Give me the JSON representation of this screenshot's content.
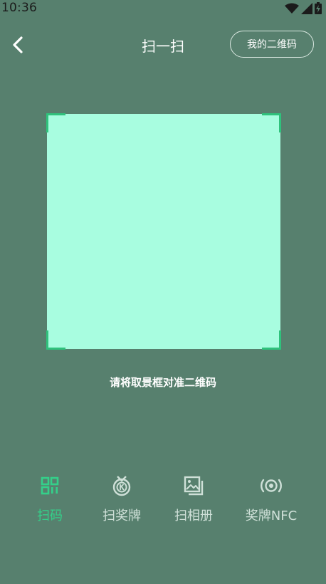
{
  "status_bar": {
    "time": "10:36",
    "icons": [
      "wifi-icon",
      "signal-icon",
      "battery-icon"
    ]
  },
  "header": {
    "back_icon": "chevron-left-icon",
    "title": "扫一扫",
    "my_qr_label": "我的二维码"
  },
  "scanner": {
    "hint": "请将取景框对准二维码",
    "frame_color": "#a8fde0",
    "corner_color": "#2fc27c"
  },
  "tabs": [
    {
      "label": "扫码",
      "icon": "qr-grid-icon",
      "active": true
    },
    {
      "label": "扫奖牌",
      "icon": "medal-icon",
      "active": false
    },
    {
      "label": "扫相册",
      "icon": "album-icon",
      "active": false
    },
    {
      "label": "奖牌NFC",
      "icon": "nfc-icon",
      "active": false
    }
  ],
  "colors": {
    "background": "#57806e",
    "active_tab": "#34d08a",
    "inactive_tab": "#cfe0d8"
  }
}
